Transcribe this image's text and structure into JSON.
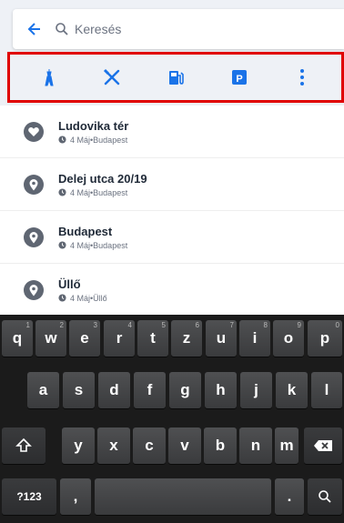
{
  "search": {
    "placeholder": "Keresés",
    "value": ""
  },
  "categories": [
    {
      "icon": "tourist-attraction-icon"
    },
    {
      "icon": "restaurant-icon"
    },
    {
      "icon": "gas-station-icon"
    },
    {
      "icon": "parking-icon",
      "label": "P"
    },
    {
      "icon": "more-options-icon"
    }
  ],
  "recents": [
    {
      "title": "Ludovika tér",
      "date": "4 Máj",
      "place": "Budapest",
      "icon": "heart-pin-icon"
    },
    {
      "title": "Delej utca 20/19",
      "date": "4 Máj",
      "place": "Budapest",
      "icon": "location-pin-icon"
    },
    {
      "title": "Budapest",
      "date": "4 Máj",
      "place": "Budapest",
      "icon": "location-pin-icon"
    },
    {
      "title": "Üllő",
      "date": "4 Máj",
      "place": "Üllő",
      "icon": "location-pin-icon"
    }
  ],
  "separator": " • ",
  "keyboard": {
    "row1": [
      {
        "k": "q",
        "h": "1"
      },
      {
        "k": "w",
        "h": "2"
      },
      {
        "k": "e",
        "h": "3"
      },
      {
        "k": "r",
        "h": "4"
      },
      {
        "k": "t",
        "h": "5"
      },
      {
        "k": "z",
        "h": "6"
      },
      {
        "k": "u",
        "h": "7"
      },
      {
        "k": "i",
        "h": "8"
      },
      {
        "k": "o",
        "h": "9"
      },
      {
        "k": "p",
        "h": "0"
      }
    ],
    "row2": [
      "a",
      "s",
      "d",
      "f",
      "g",
      "h",
      "j",
      "k",
      "l"
    ],
    "row3": [
      "y",
      "x",
      "c",
      "v",
      "b",
      "n",
      "m"
    ],
    "symbols_label": "?123",
    "comma": ",",
    "period": "."
  },
  "colors": {
    "accent": "#1a73e8",
    "highlight_border": "#e00000",
    "pin": "#5f6672"
  }
}
